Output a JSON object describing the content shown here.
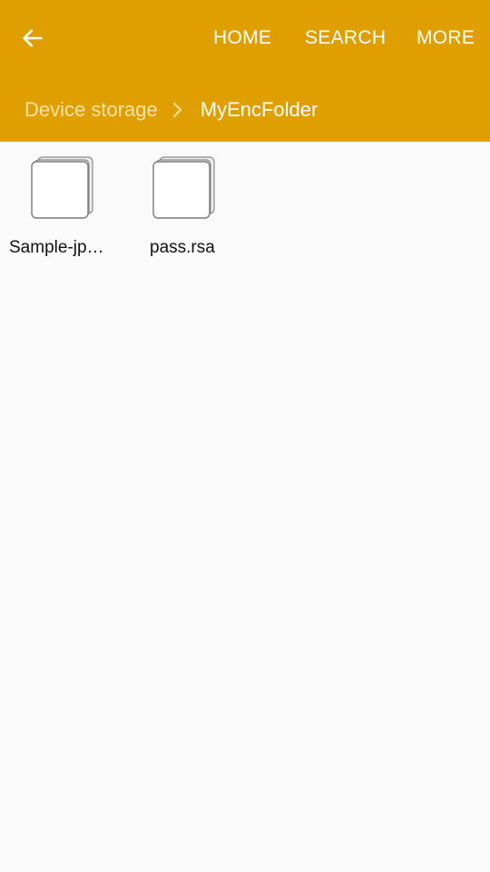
{
  "colors": {
    "header_bg": "#e09f00",
    "content_bg": "#fafafa",
    "breadcrumb_parent": "#fbe2a6",
    "text_white": "#ffffff"
  },
  "toolbar": {
    "back_icon": "arrow-left-icon",
    "actions": [
      {
        "label": "HOME"
      },
      {
        "label": "SEARCH"
      },
      {
        "label": "MORE"
      }
    ]
  },
  "breadcrumb": {
    "parent": "Device storage",
    "separator_icon": "chevron-right-icon",
    "current": "MyEncFolder"
  },
  "files": [
    {
      "name": "Sample-jpg…",
      "icon": "file-icon"
    },
    {
      "name": "pass.rsa",
      "icon": "file-icon"
    }
  ]
}
